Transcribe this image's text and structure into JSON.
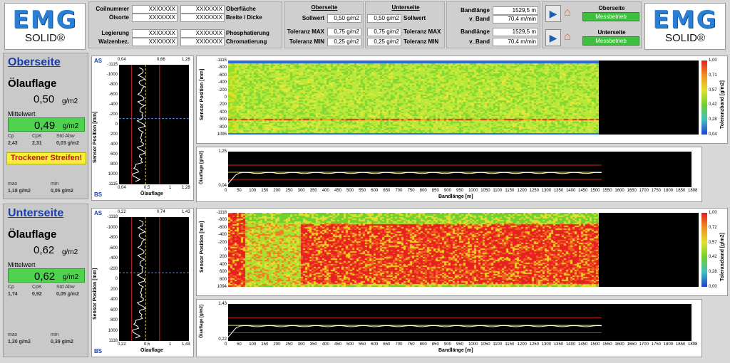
{
  "logo": {
    "brand": "EMG",
    "product": "SOLID®"
  },
  "header": {
    "left_labels": [
      "Coilnummer",
      "Ölsorte",
      "Legierung",
      "Walzenbez."
    ],
    "left_vals": [
      "XXXXXXX",
      "XXXXXXX",
      "XXXXXXX",
      "XXXXXXX"
    ],
    "mid_vals": [
      "XXXXXXX",
      "XXXXXXX",
      "XXXXXXX",
      "XXXXXXX"
    ],
    "mid_labels": [
      "Oberfläche",
      "Breite / Dicke",
      "Phosphatierung",
      "Chromatierung"
    ],
    "ober_title": "Oberseite",
    "unter_title": "Unterseite",
    "row_labels": [
      "Sollwert",
      "Toleranz MAX",
      "Toleranz MIN"
    ],
    "ober_vals": [
      "0,50 g/m2",
      "0,75 g/m2",
      "0,25 g/m2"
    ],
    "unter_vals": [
      "0,50 g/m2",
      "0,75 g/m2",
      "0,25 g/m2"
    ],
    "band_labels": [
      "Bandlänge",
      "v_Band"
    ],
    "band_top": [
      "1529,5 m",
      "70,4 m/min"
    ],
    "band_bot": [
      "1529,5 m",
      "70,4 m/min"
    ],
    "status_top_title": "Oberseite",
    "status_top": "Messbetrieb",
    "status_bot_title": "Unterseite",
    "status_bot": "Messbetrieb"
  },
  "sides": [
    {
      "title": "Oberseite",
      "oel": "Ölauflage",
      "value": "0,50",
      "unit": "g/m2",
      "mittel": "Mittelwert",
      "mittel_val": "0,49",
      "stats_labels": [
        "Cp",
        "CpK",
        "Std Abw"
      ],
      "stats_vals": [
        "2,43",
        "2,31",
        "0,03 g/m2"
      ],
      "warning": "Trockener Streifen!",
      "max_label": "max",
      "min_label": "min",
      "max_val": "1,18 g/m2",
      "min_val": "0,05 g/m2"
    },
    {
      "title": "Unterseite",
      "oel": "Ölauflage",
      "value": "0,62",
      "unit": "g/m2",
      "mittel": "Mittelwert",
      "mittel_val": "0,62",
      "stats_labels": [
        "Cp",
        "CpK",
        "Std Abw"
      ],
      "stats_vals": [
        "1,74",
        "0,92",
        "0,05 g/m2"
      ],
      "warning": "",
      "max_label": "max",
      "min_label": "min",
      "max_val": "1,30 g/m2",
      "min_val": "0,39 g/m2"
    }
  ],
  "profile": [
    {
      "as": "AS",
      "bs": "BS",
      "top_ticks": [
        "0,04",
        "0,66",
        "1,28"
      ],
      "bot_ticks": [
        "0,04",
        "0,5",
        "1",
        "1,28"
      ],
      "y_ticks": [
        "-1115",
        "-1000",
        "-800",
        "-600",
        "-400",
        "-200",
        "0",
        "200",
        "400",
        "600",
        "800",
        "1000",
        "1115"
      ],
      "ylabel": "Sensor Position [mm]",
      "xlabel": "Ölauflage"
    },
    {
      "as": "AS",
      "bs": "BS",
      "top_ticks": [
        "0,22",
        "0,74",
        "1,43"
      ],
      "bot_ticks": [
        "0,22",
        "0,5",
        "1",
        "1,43"
      ],
      "y_ticks": [
        "-1118",
        "-1000",
        "-800",
        "-600",
        "-400",
        "-200",
        "0",
        "200",
        "400",
        "600",
        "800",
        "1000",
        "1118"
      ],
      "ylabel": "Sensor Position [mm]",
      "xlabel": "Ölauflage"
    }
  ],
  "heatmap": [
    {
      "y_ticks": [
        "-1115",
        "-800",
        "-600",
        "-400",
        "-200",
        "0",
        "200",
        "400",
        "600",
        "800",
        "1095"
      ],
      "ylabel": "Sensor Position [mm]",
      "scale_ticks": [
        "1,00",
        "0,71",
        "0,57",
        "0,42",
        "0,28",
        "0,04"
      ],
      "scale_label": "Toleranzband [g/m2]"
    },
    {
      "y_ticks": [
        "-1118",
        "-800",
        "-600",
        "-400",
        "-200",
        "0",
        "200",
        "400",
        "600",
        "800",
        "1094"
      ],
      "ylabel": "Sensor Position [mm]",
      "scale_ticks": [
        "1,00",
        "0,72",
        "0,57",
        "0,42",
        "0,28",
        "0,00"
      ],
      "scale_label": "Toleranzband [g/m2]"
    }
  ],
  "trend": [
    {
      "y_ticks": [
        "1,25",
        "0,04"
      ],
      "ylabel": "Ölauflage [g/m2]",
      "xlabel": "Bandlänge [m]"
    },
    {
      "y_ticks": [
        "1,43",
        "0,22"
      ],
      "ylabel": "Ölauflage [g/m2]",
      "xlabel": "Bandlänge [m]"
    }
  ],
  "x_ticks": [
    "0",
    "50",
    "100",
    "150",
    "200",
    "250",
    "300",
    "350",
    "400",
    "450",
    "500",
    "550",
    "600",
    "650",
    "700",
    "750",
    "800",
    "850",
    "900",
    "950",
    "1000",
    "1050",
    "1100",
    "1150",
    "1200",
    "1250",
    "1300",
    "1350",
    "1400",
    "1450",
    "1500",
    "1550",
    "1600",
    "1650",
    "1700",
    "1750",
    "1800",
    "1850",
    "1898"
  ]
}
